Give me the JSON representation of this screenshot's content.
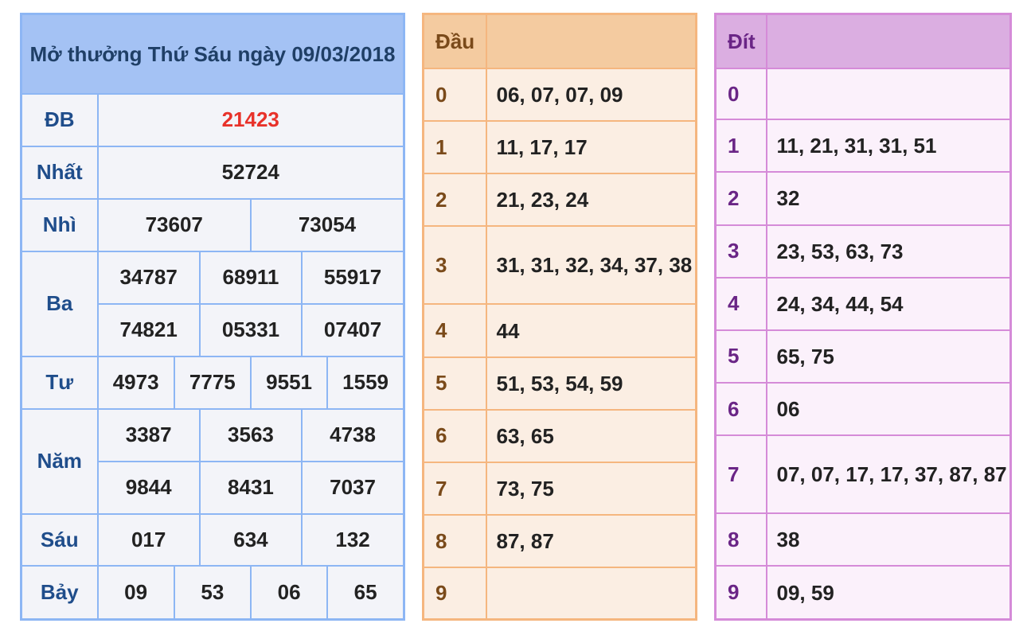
{
  "results": {
    "title": "Mở thưởng Thứ Sáu ngày 09/03/2018",
    "prizes": {
      "db": {
        "label": "ĐB",
        "values": [
          "21423"
        ]
      },
      "nhat": {
        "label": "Nhất",
        "values": [
          "52724"
        ]
      },
      "nhi": {
        "label": "Nhì",
        "values": [
          "73607",
          "73054"
        ]
      },
      "ba": {
        "label": "Ba",
        "values": [
          "34787",
          "68911",
          "55917",
          "74821",
          "05331",
          "07407"
        ]
      },
      "tu": {
        "label": "Tư",
        "values": [
          "4973",
          "7775",
          "9551",
          "1559"
        ]
      },
      "nam": {
        "label": "Năm",
        "values": [
          "3387",
          "3563",
          "4738",
          "9844",
          "8431",
          "7037"
        ]
      },
      "sau": {
        "label": "Sáu",
        "values": [
          "017",
          "634",
          "132"
        ]
      },
      "bay": {
        "label": "Bảy",
        "values": [
          "09",
          "53",
          "06",
          "65"
        ]
      }
    },
    "colors": {
      "special": "#e8322a",
      "border": "#8db6f4",
      "header_bg": "#a4c2f4"
    }
  },
  "dau": {
    "header": "Đầu",
    "rows": [
      {
        "key": "0",
        "values": "06, 07, 07, 09"
      },
      {
        "key": "1",
        "values": "11, 17, 17"
      },
      {
        "key": "2",
        "values": "21, 23, 24"
      },
      {
        "key": "3",
        "values": "31, 31, 32, 34, 37, 38"
      },
      {
        "key": "4",
        "values": "44"
      },
      {
        "key": "5",
        "values": "51, 53, 54, 59"
      },
      {
        "key": "6",
        "values": "63, 65"
      },
      {
        "key": "7",
        "values": "73, 75"
      },
      {
        "key": "8",
        "values": "87, 87"
      },
      {
        "key": "9",
        "values": ""
      }
    ],
    "colors": {
      "border": "#f5b67f",
      "header_bg": "#f4cba0"
    }
  },
  "dit": {
    "header": "Đít",
    "rows": [
      {
        "key": "0",
        "values": ""
      },
      {
        "key": "1",
        "values": "11, 21, 31, 31, 51"
      },
      {
        "key": "2",
        "values": "32"
      },
      {
        "key": "3",
        "values": "23, 53, 63, 73"
      },
      {
        "key": "4",
        "values": "24, 34, 44, 54"
      },
      {
        "key": "5",
        "values": "65, 75"
      },
      {
        "key": "6",
        "values": "06"
      },
      {
        "key": "7",
        "values": "07, 07, 17, 17, 37, 87, 87"
      },
      {
        "key": "8",
        "values": "38"
      },
      {
        "key": "9",
        "values": "09, 59"
      }
    ],
    "colors": {
      "border": "#d58bd8",
      "header_bg": "#dbaee1"
    }
  }
}
